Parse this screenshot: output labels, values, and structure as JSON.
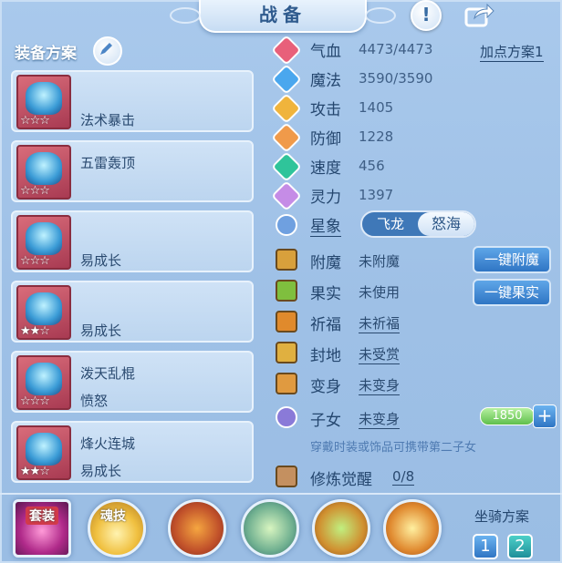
{
  "window": {
    "title": "战备"
  },
  "left": {
    "title": "装备方案",
    "cards": [
      {
        "line1": "",
        "line2": "法术暴击",
        "stars": "☆☆☆"
      },
      {
        "line1": "五雷轰顶",
        "line2": "",
        "stars": "☆☆☆"
      },
      {
        "line1": "",
        "line2": "易成长",
        "stars": "☆☆☆"
      },
      {
        "line1": "",
        "line2": "易成长",
        "stars": "★★☆"
      },
      {
        "line1": "泼天乱棍",
        "line2": "愤怒",
        "stars": "☆☆☆"
      },
      {
        "line1": "烽火连城",
        "line2": "易成长",
        "stars": "★★☆"
      }
    ]
  },
  "stats": {
    "add_plan": "加点方案1",
    "rows": [
      {
        "label": "气血",
        "value": "4473/4473",
        "color": "#e8607a"
      },
      {
        "label": "魔法",
        "value": "3590/3590",
        "color": "#4aa7ee"
      },
      {
        "label": "攻击",
        "value": "1405",
        "color": "#f0b43c"
      },
      {
        "label": "防御",
        "value": "1228",
        "color": "#f09a4a"
      },
      {
        "label": "速度",
        "value": "456",
        "color": "#2fc49a"
      },
      {
        "label": "灵力",
        "value": "1397",
        "color": "#c58ce6"
      }
    ],
    "star": {
      "label": "星象",
      "options": [
        "飞龙",
        "怒海"
      ],
      "selected": "怒海"
    }
  },
  "bonus": {
    "rows": [
      {
        "label": "附魔",
        "value": "未附魔",
        "color": "#d8a03c"
      },
      {
        "label": "果实",
        "value": "未使用",
        "color": "#7fbf3e"
      },
      {
        "label": "祈福",
        "value": "未祈福",
        "color": "#e08a2c"
      },
      {
        "label": "封地",
        "value": "未受赏",
        "color": "#e0b040"
      },
      {
        "label": "变身",
        "value": "未变身",
        "color": "#e09a40"
      }
    ],
    "child": {
      "label": "子女",
      "value": "未变身",
      "points": "1850"
    },
    "hint": "穿戴时装或饰品可携带第二子女",
    "practice": {
      "label": "修炼觉醒",
      "value": "0/8"
    },
    "btn_enchant": "一键附魔",
    "btn_fruit": "一键果实"
  },
  "bottom": {
    "tag_set": "套装",
    "tag_soul": "魂技",
    "mount_title": "坐骑方案",
    "mount_buttons": [
      "1",
      "2"
    ]
  }
}
